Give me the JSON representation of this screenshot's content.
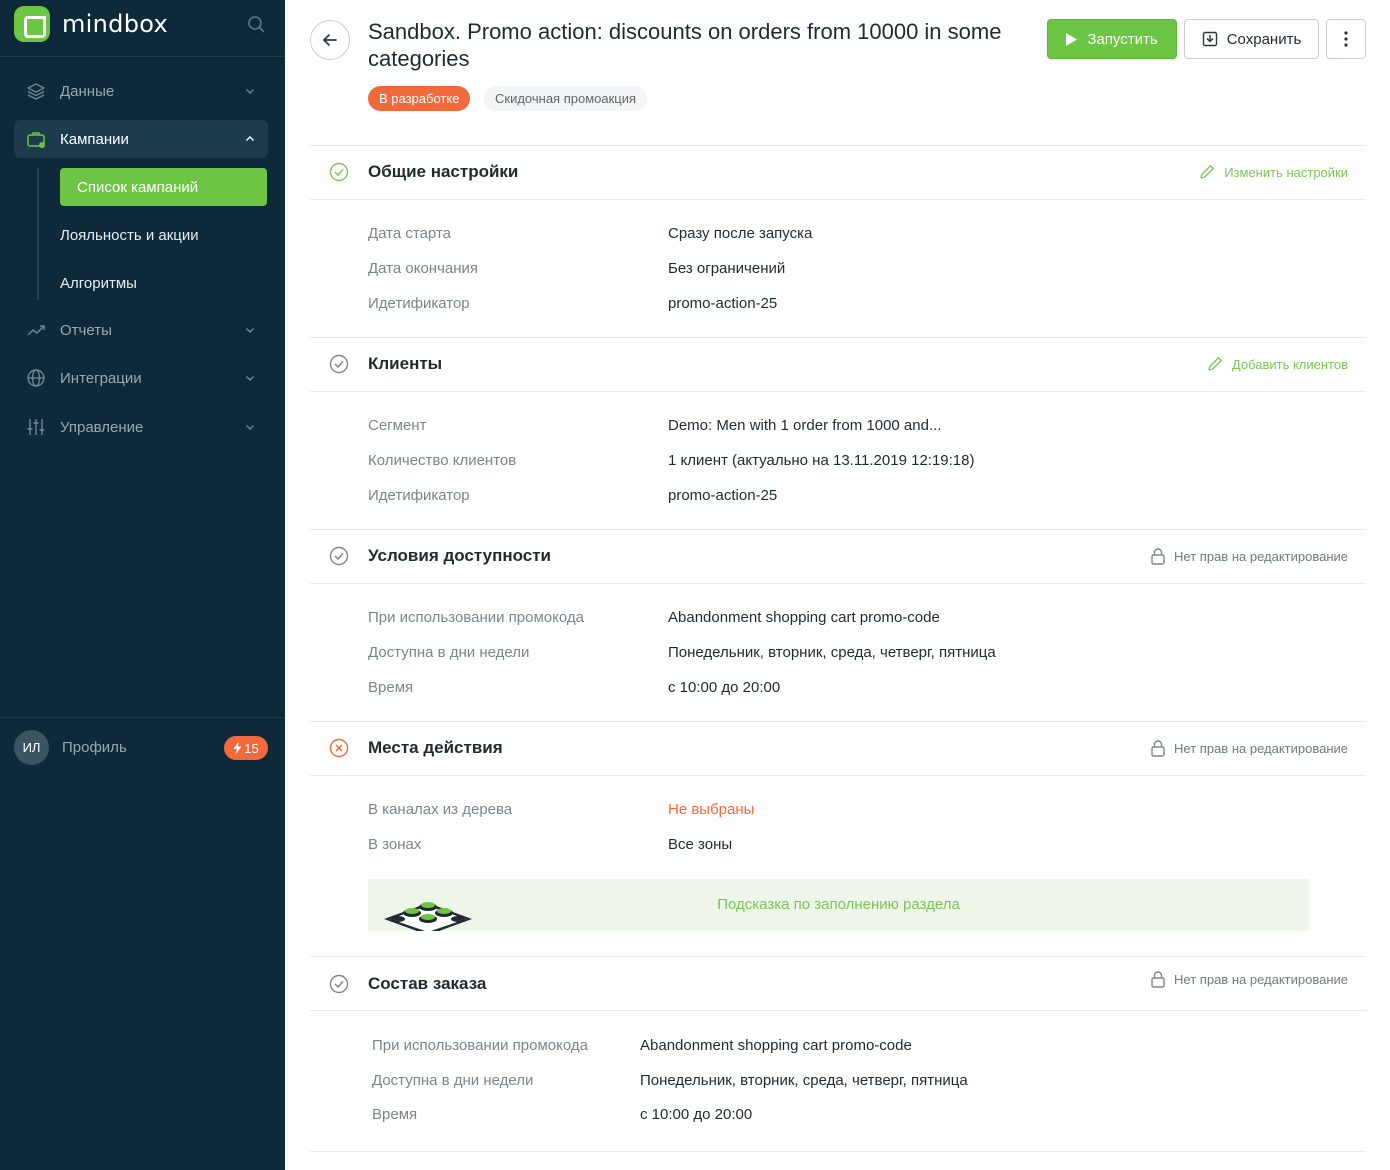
{
  "brand": {
    "name": "mindbox"
  },
  "sidebar": {
    "nav": [
      {
        "label": "Данные"
      },
      {
        "label": "Кампании"
      },
      {
        "label": "Отчеты"
      },
      {
        "label": "Интеграции"
      },
      {
        "label": "Управление"
      }
    ],
    "sub_items": [
      {
        "label": "Список кампаний"
      },
      {
        "label": "Лояльность и акции"
      },
      {
        "label": "Алгоритмы"
      }
    ],
    "profile": {
      "initials": "ИЛ",
      "label": "Профиль",
      "badge": "15"
    }
  },
  "header": {
    "title": "Sandbox. Promo action: discounts on orders from 10000 in some categories",
    "status": "В разработке",
    "type": "Скидочная промоакция",
    "run_label": "Запустить",
    "save_label": "Сохранить"
  },
  "sections": [
    {
      "title": "Общие настройки",
      "action": "Изменить настройки",
      "rows": [
        {
          "label": "Дата старта",
          "value": "Сразу после запуска"
        },
        {
          "label": "Дата окончания",
          "value": "Без ограничений"
        },
        {
          "label": "Идетификатор",
          "value": "promo-action-25"
        }
      ]
    },
    {
      "title": "Клиенты",
      "action": "Добавить клиентов",
      "rows": [
        {
          "label": "Сегмент",
          "value": "Demo: Men with 1 order from 1000 and..."
        },
        {
          "label": "Количество клиентов",
          "value": "1 клиент (актуально на 13.11.2019 12:19:18)"
        },
        {
          "label": "Идетификатор",
          "value": "promo-action-25"
        }
      ]
    },
    {
      "title": "Условия доступности",
      "action": "Нет прав на редактирование",
      "rows": [
        {
          "label": "При использовании промокода",
          "value": "Abandonment shopping cart promo-code"
        },
        {
          "label": "Доступна в дни недели",
          "value": "Понедельник, вторник, среда, четверг, пятница"
        },
        {
          "label": "Время",
          "value": "с 10:00 до 20:00"
        }
      ]
    },
    {
      "title": "Места действия",
      "action": "Нет прав на редактирование",
      "rows": [
        {
          "label": "В каналах из дерева",
          "value": "Не выбраны"
        },
        {
          "label": "В зонах",
          "value": "Все зоны"
        }
      ],
      "hint": "Подсказка по заполнению раздела"
    },
    {
      "title": "Состав заказа",
      "action": "Нет прав на редактирование",
      "rows": [
        {
          "label": "При использовании промокода",
          "value": "Abandonment shopping cart promo-code"
        },
        {
          "label": "Доступна в дни недели",
          "value": "Понедельник, вторник, среда, четверг, пятница"
        },
        {
          "label": "Время",
          "value": "с 10:00 до 20:00"
        }
      ]
    }
  ],
  "colors": {
    "sidebar_bg": "#0e2a3a",
    "accent_green": "#6cc644",
    "accent_orange": "#f06a3c"
  }
}
